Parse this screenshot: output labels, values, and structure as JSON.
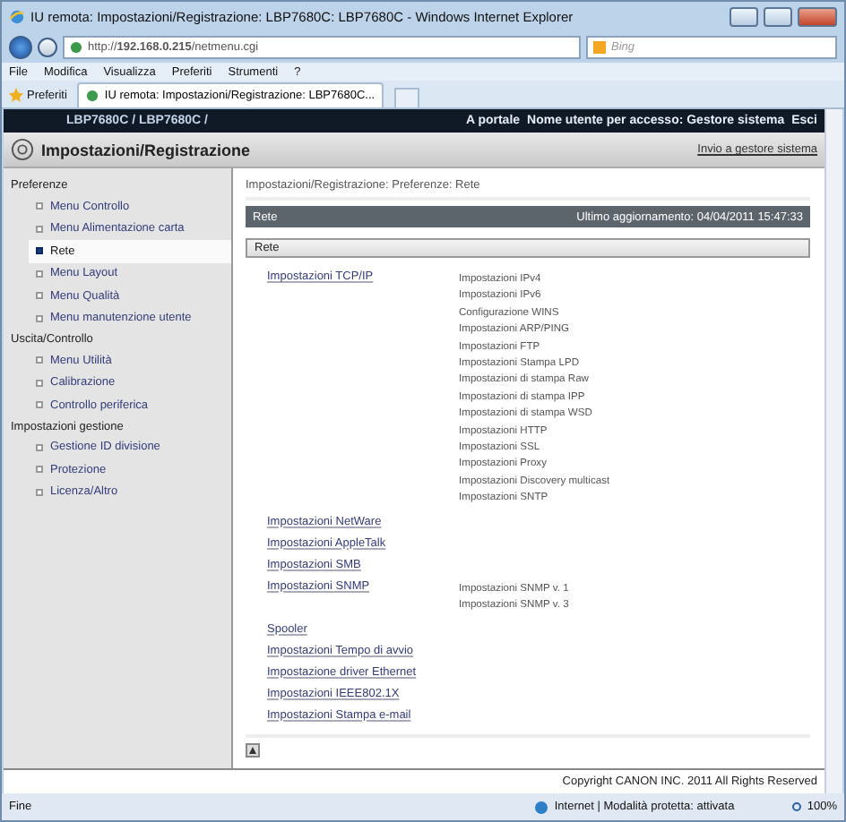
{
  "window": {
    "title": "IU remota: Impostazioni/Registrazione: LBP7680C: LBP7680C - Windows Internet Explorer"
  },
  "address": {
    "url": "http://**192.168.0.215**/netmenu.cgi"
  },
  "search": {
    "placeholder": "Bing"
  },
  "menu": [
    "File",
    "Modifica",
    "Visualizza",
    "Preferiti",
    "Strumenti",
    "?"
  ],
  "favorites": {
    "label": "Preferiti",
    "tab": "IU remota: Impostazioni/Registrazione: LBP7680C..."
  },
  "header": {
    "path": "LBP7680C / LBP7680C /",
    "portal": "A portale",
    "user": "Nome utente per accesso: Gestore sistema",
    "logout": "Esci"
  },
  "title": {
    "text": "Impostazioni/Registrazione",
    "link": "Invio a gestore sistema"
  },
  "sidebar": [
    {
      "group": "Preferenze",
      "items": [
        {
          "label": "Menu Controllo",
          "selected": false
        },
        {
          "label": "Menu Alimentazione carta",
          "selected": false
        },
        {
          "label": "Rete",
          "selected": true
        },
        {
          "label": "Menu Layout",
          "selected": false
        },
        {
          "label": "Menu Qualità",
          "selected": false
        },
        {
          "label": "Menu manutenzione utente",
          "selected": false
        }
      ]
    },
    {
      "group": "Uscita/Controllo",
      "items": [
        {
          "label": "Menu Utilità",
          "selected": false
        },
        {
          "label": "Calibrazione",
          "selected": false
        },
        {
          "label": "Controllo periferica",
          "selected": false
        }
      ]
    },
    {
      "group": "Impostazioni gestione",
      "items": [
        {
          "label": "Gestione ID divisione",
          "selected": false
        },
        {
          "label": "Protezione",
          "selected": false
        },
        {
          "label": "Licenza/Altro",
          "selected": false
        }
      ]
    }
  ],
  "breadcrumb": "Impostazioni/Registrazione: Preferenze: Rete",
  "panel": {
    "title": "Rete",
    "updated": "Ultimo aggiornamento: 04/04/2011 15:47:33",
    "section": "Rete"
  },
  "settings": [
    {
      "label": "Impostazioni TCP/IP",
      "children": [
        "Impostazioni IPv4",
        "Impostazioni IPv6",
        "Configurazione WINS",
        "Impostazioni ARP/PING",
        "Impostazioni FTP",
        "Impostazioni Stampa LPD",
        "Impostazioni di stampa Raw",
        "Impostazioni di stampa IPP",
        "Impostazioni di stampa WSD",
        "Impostazioni HTTP",
        "Impostazioni SSL",
        "Impostazioni Proxy",
        "Impostazioni Discovery multicast",
        "Impostazioni SNTP"
      ]
    },
    {
      "label": "Impostazioni NetWare"
    },
    {
      "label": "Impostazioni AppleTalk"
    },
    {
      "label": "Impostazioni SMB"
    },
    {
      "label": "Impostazioni SNMP",
      "children": [
        "Impostazioni SNMP v. 1",
        "Impostazioni SNMP v. 3"
      ]
    },
    {
      "label": "Spooler"
    },
    {
      "label": "Impostazioni Tempo di avvio"
    },
    {
      "label": "Impostazione driver Ethernet"
    },
    {
      "label": "Impostazioni IEEE802.1X"
    },
    {
      "label": "Impostazioni Stampa e-mail"
    }
  ],
  "copyright": "Copyright CANON INC. 2011 All Rights Reserved",
  "status": {
    "text": "Fine",
    "zone": "Internet | Modalità protetta: attivata",
    "zoom": "100%"
  }
}
